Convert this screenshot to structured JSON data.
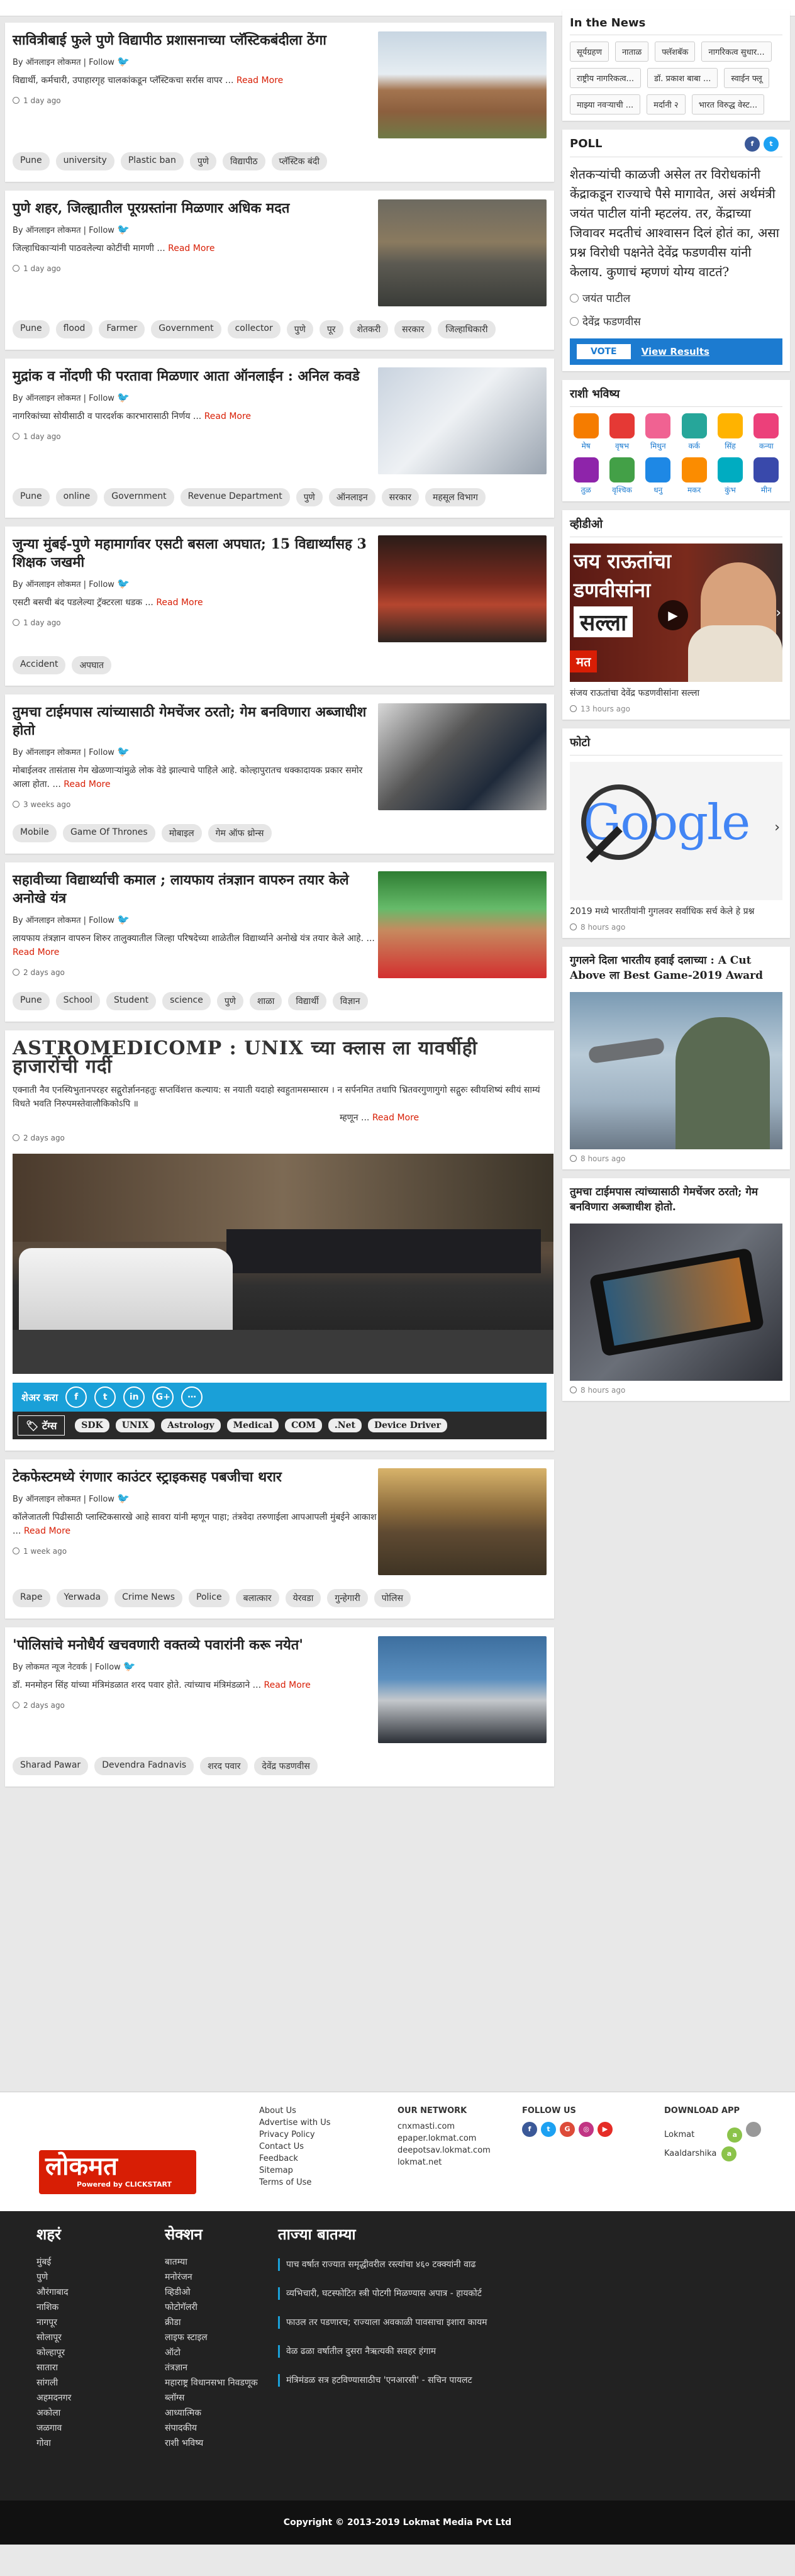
{
  "articles": [
    {
      "title": "सावित्रीबाई फुले पुणे विद्यापीठ प्रशासनाच्या प्लॅस्टिकबंदीला ठेंगा",
      "byline": "By ऑनलाइन लोकमत | Follow",
      "summary": "विद्यार्थी, कर्मचारी, उपाहारगृह चालकांकडून प्लॅस्टिकचा सर्रास वापर ...",
      "read_more": "Read More",
      "time": "1 day ago",
      "tags": [
        "Pune",
        "university",
        "Plastic ban",
        "पुणे",
        "विद्यापीठ",
        "प्लॅस्टिक बंदी"
      ]
    },
    {
      "title": "पुणे शहर, जिल्ह्यातील पूरग्रस्तांना मिळणार अधिक मदत",
      "byline": "By ऑनलाइन लोकमत | Follow",
      "summary": "जिल्हाधिकाऱ्यांनी पाठवलेल्या कोटींची मागणी ...",
      "read_more": "Read More",
      "time": "1 day ago",
      "tags": [
        "Pune",
        "flood",
        "Farmer",
        "Government",
        "collector",
        "पुणे",
        "पूर",
        "शेतकरी",
        "सरकार",
        "जिल्हाधिकारी"
      ]
    },
    {
      "title": "मुद्रांक व नोंदणी फी परतावा मिळणार आता ऑनलाईन : अनिल कवडे",
      "byline": "By ऑनलाइन लोकमत | Follow",
      "summary": "नागरिकांच्या सोयीसाठी व पारदर्शक कारभारासाठी निर्णय ...",
      "read_more": "Read More",
      "time": "1 day ago",
      "tags": [
        "Pune",
        "online",
        "Government",
        "Revenue Department",
        "पुणे",
        "ऑनलाइन",
        "सरकार",
        "महसूल विभाग"
      ]
    },
    {
      "title": "जुन्या मुंबई-पुणे महामार्गावर एसटी बसला अपघात; 15 विद्यार्थ्यांसह 3 शिक्षक जखमी",
      "byline": "By ऑनलाइन लोकमत | Follow",
      "summary": "एसटी बसची बंद पडलेल्या ट्रॅक्टरला धडक ...",
      "read_more": "Read More",
      "time": "1 day ago",
      "tags": [
        "Accident",
        "अपघात"
      ]
    },
    {
      "title": "तुमचा टाईमपास त्यांच्यासाठी गेमचेंजर ठरतो; गेम बनविणारा अब्जाधीश होतो",
      "byline": "By ऑनलाइन लोकमत | Follow",
      "summary": "मोबाईलवर तासंतास गेम खेळणाऱ्यांमुळे लोक वेडे झाल्याचे पाहिले आहे. कोल्हापुरातच धक्कादायक प्रकार समोर आला होता. ...",
      "read_more": "Read More",
      "time": "3 weeks ago",
      "tags": [
        "Mobile",
        "Game Of Thrones",
        "मोबाइल",
        "गेम ऑफ थ्रोन्स"
      ]
    },
    {
      "title": "सहावीच्या विद्यार्थ्याची कमाल ; लायफाय तंत्रज्ञान वापरुन तयार केले अनोखे यंत्र",
      "byline": "By ऑनलाइन लोकमत | Follow",
      "summary": "लायफाय तंत्रज्ञान वापरुन शिरुर तालुक्यातील जिल्हा परिषदेच्या शाळेतील विद्यार्थ्याने अनोखे यंत्र तयार केले आहे. ...",
      "read_more": "Read More",
      "time": "2 days ago",
      "tags": [
        "Pune",
        "School",
        "Student",
        "science",
        "पुणे",
        "शाळा",
        "विद्यार्थी",
        "विज्ञान"
      ]
    }
  ],
  "astro": {
    "title": "ASTROMEDICOMP : UNIX च्या क्लास ला यावर्षीही  हाजारोंची गर्दी",
    "sanskrit": "एक्नाती नैव एनस्यिभुतानपरहर सद्गुरोर्ज्ञाननहतुः सप्तविंशत्त कल्याय: स नयाती यदाहो स्वहुतामसम्सारम । न सर्पनमित तथापि भ्रितवरगुणागुगो सद्गुरुः स्वीयशिष्यं स्वीयं साम्यं विधते भवति निरुपमस्तेवालौकिकोऽपि ॥",
    "attribution": "म्हणून",
    "read_more": "Read More",
    "time": "2 days ago",
    "share_label": "शेअर करा",
    "tags_label": "टॅग्स",
    "tags": [
      "SDK",
      "UNIX",
      "Astrology",
      "Medical",
      "COM",
      ".Net",
      "Device Driver"
    ]
  },
  "articles2": [
    {
      "title": "टेकफेस्टमध्ये रंगणार काउंटर स्ट्राइकसह पबजीचा थरार",
      "byline": "By ऑनलाइन लोकमत | Follow",
      "summary": "कॉलेजातली पिढीसाठी प्लास्टिकसारखे आहे सावरा यांनी म्हणून पाहा; तंत्रवेदा तरुणाईला आपआपली मुंबईने आकाश ...",
      "read_more": "Read More",
      "time": "1 week ago",
      "tags": [
        "Rape",
        "Yerwada",
        "Crime News",
        "Police",
        "बलात्कार",
        "येरवडा",
        "गुन्हेगारी",
        "पोलिस"
      ]
    },
    {
      "title": "'पोलिसांचे मनोधैर्य खचवणारी वक्तव्ये पवारांनी करू नयेत'",
      "byline": "By लोकमत न्यूज नेटवर्क | Follow",
      "summary": "डॉ. मनमोहन सिंह यांच्या मंत्रिमंडळात शरद पवार होते. त्यांच्याच मंत्रिमंडळाने ...",
      "read_more": "Read More",
      "time": "2 days ago",
      "tags": [
        "Sharad Pawar",
        "Devendra Fadnavis",
        "शरद पवार",
        "देवेंद्र फडणवीस"
      ]
    }
  ],
  "sidebar": {
    "in_news_title": "In the News",
    "in_news": [
      "सूर्यग्रहण",
      "नाताळ",
      "फ्लॅशबॅक",
      "नागरिकत्व सुधार...",
      "राष्ट्रीय नागरिकत्व...",
      "डॉ. प्रकाश बाबा ...",
      "स्वाईन फ्लू",
      "माझ्या नवऱ्याची ...",
      "मर्दानी २",
      "भारत विरुद्ध वेस्ट..."
    ],
    "poll_title": "POLL",
    "poll_question": "शेतकऱ्यांची काळजी असेल तर विरोधकांनी केंद्राकडून राज्याचे पैसे मागावेत, असं अर्थमंत्री जयंत पाटील यांनी म्हटलंय. तर, केंद्राच्या जिवावर मदतीचं आश्वासन दिलं होतं का, असा प्रश्न विरोधी पक्षनेते देवेंद्र फडणवीस यांनी केलाय. कुणाचं म्हणणं योग्य वाटतं?",
    "poll_options": [
      "जयंत पाटील",
      "देवेंद्र फडणवीस"
    ],
    "vote_label": "VOTE",
    "view_results": "View Results",
    "rashi_title": "राशी भविष्य",
    "rashi": [
      "मेष",
      "वृषभ",
      "मिथुन",
      "कर्क",
      "सिंह",
      "कन्या",
      "तुळ",
      "वृश्चिक",
      "धनु",
      "मकर",
      "कुंभ",
      "मीन"
    ],
    "video_title": "व्हीडीओ",
    "video_banner_top": "जय राऊतांचा",
    "video_banner_mid": "डणवीसांना",
    "video_banner_bot": "सल्ला",
    "video_tag": "मत",
    "video_caption": "संजय राऊतांचा देवेंद्र फडणवीसांना सल्ला",
    "video_time": "13 hours ago",
    "photo_title": "फोटो",
    "photo_brand": "Google",
    "photo_caption": "2019 मध्ये भारतीयांनी गुगलवर सर्वाधिक सर्च केले हे प्रश्न",
    "photo_time": "8 hours ago",
    "card1_title": "गुगलने दिला भारतीय हवाई दलाच्या : A Cut Above ला  Best Game-2019 Award",
    "card1_time": "8 hours ago",
    "card2_title": "तुमचा टाईमपास त्यांच्यासाठी गेमचेंजर ठरतो; गेम बनविणारा अब्जाधीश होतो.",
    "card2_time": "8 hours ago"
  },
  "footer": {
    "brand": "लोकमत",
    "powered": "Powered by CLICKSTART",
    "links": [
      "About Us",
      "Advertise with Us",
      "Privacy Policy",
      "Contact Us",
      "Feedback",
      "Sitemap",
      "Terms of Use"
    ],
    "network_title": "OUR NETWORK",
    "network": [
      "cnxmasti.com",
      "epaper.lokmat.com",
      "deepotsav.lokmat.com",
      "lokmat.net"
    ],
    "follow_title": "FOLLOW US",
    "download_title": "DOWNLOAD APP",
    "apps": [
      "Lokmat",
      "Kaaldarshika"
    ],
    "city_title": "शहरं",
    "cities": [
      "मुंबई",
      "पुणे",
      "औरंगाबाद",
      "नाशिक",
      "नागपूर",
      "सोलापूर",
      "कोल्हापूर",
      "सातारा",
      "सांगली",
      "अहमदनगर",
      "अकोला",
      "जळगाव",
      "गोवा"
    ],
    "section_title": "सेक्शन",
    "sections": [
      "बातम्या",
      "मनोरंजन",
      "व्हिडीओ",
      "फोटोगॅलरी",
      "क्रीडा",
      "लाइफ स्टाइल",
      "ऑटो",
      "तंत्रज्ञान",
      "महाराष्ट्र विधानसभा निवडणूक",
      "ब्लॉग्स",
      "आध्यात्मिक",
      "संपादकीय",
      "राशी भविष्य"
    ],
    "latest_title": "ताज्या बातम्या",
    "latest": [
      "पाच वर्षात राज्यात समृद्धीवरील रस्त्यांचा ४६० टक्क्यांनी वाढ",
      "व्यभिचारी, घटस्फोटित स्त्री पोटगी मिळण्यास अपात्र - हायकोर्ट",
      "फाउल तर पडणारच; राज्याला अवकाळी पावसाचा इशारा कायम",
      "वेळ ढळा वर्षातील दुसरा नैऋत्यकी सवहर हंगाम",
      "मंत्रिमंडळ सत्र हटविण्यासाठीच 'एनआरसी' - सचिन पायलट"
    ],
    "copyright": "Copyright © 2013-2019 Lokmat Media Pvt Ltd"
  }
}
